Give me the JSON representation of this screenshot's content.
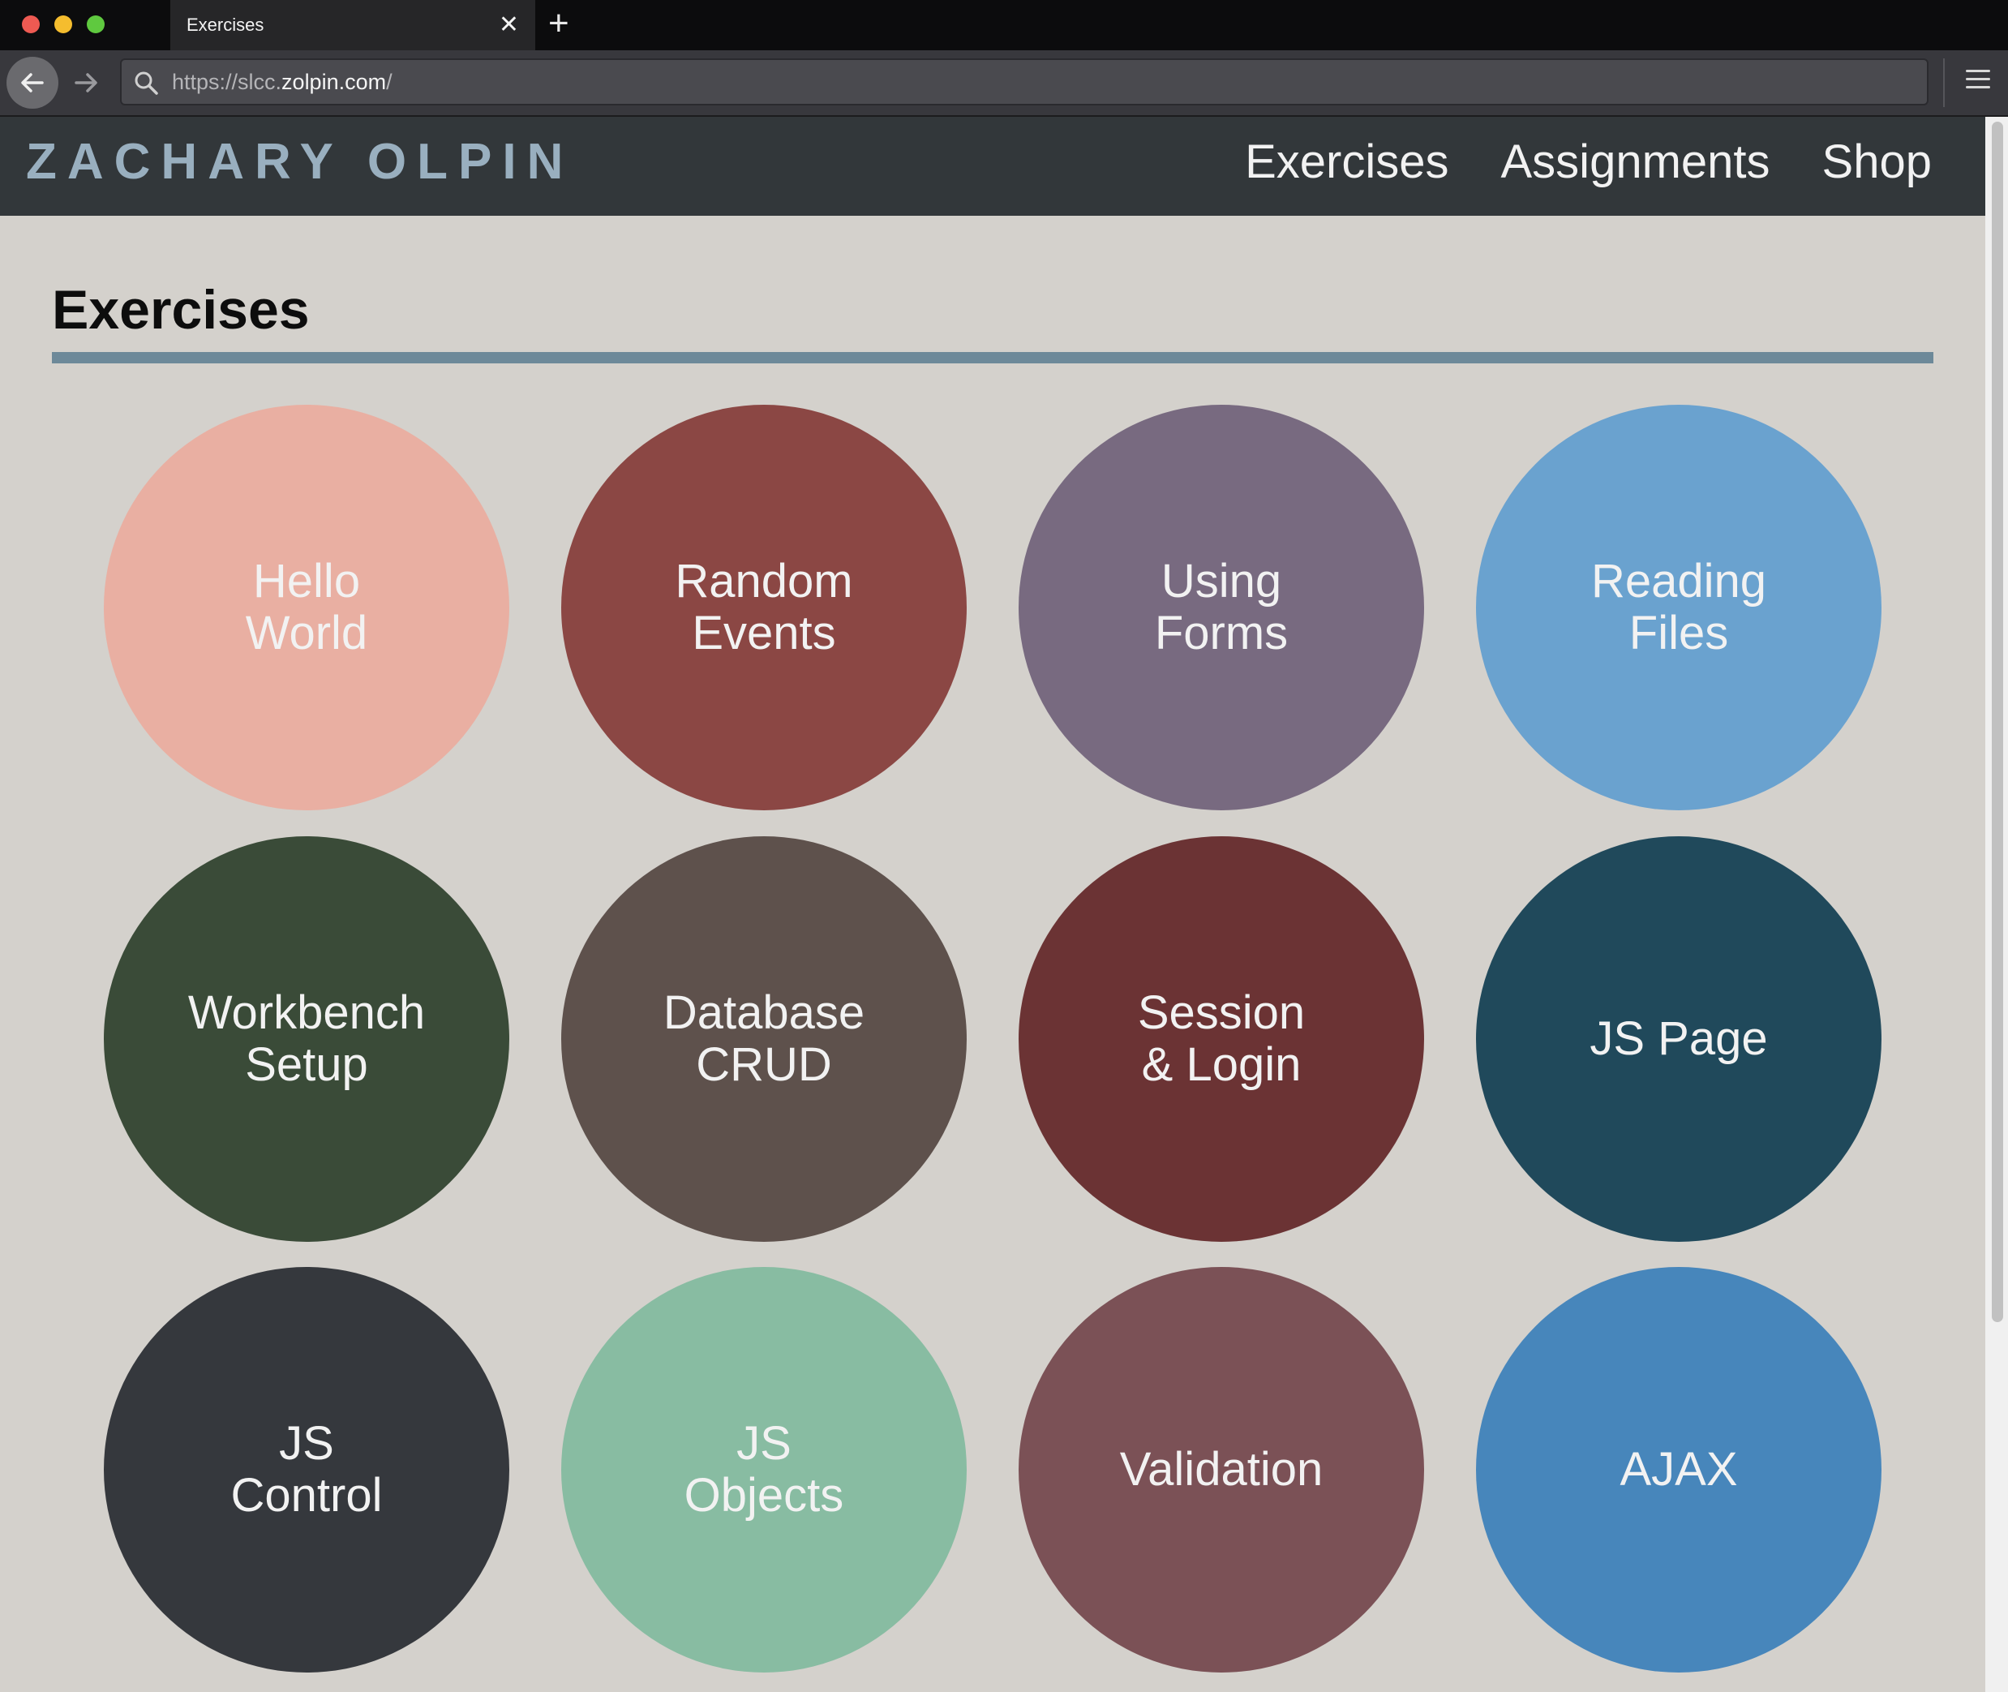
{
  "browser": {
    "tab_title": "Exercises",
    "tab_close": "✕",
    "new_tab": "+",
    "url_prefix": "https://slcc.",
    "url_domain": "zolpin.com",
    "url_suffix": "/"
  },
  "site": {
    "logo": "ZACHARY OLPIN",
    "nav": [
      "Exercises",
      "Assignments",
      "Shop"
    ]
  },
  "page": {
    "title": "Exercises"
  },
  "exercises": [
    {
      "label": "Hello\nWorld",
      "color": "#e9afa2"
    },
    {
      "label": "Random\nEvents",
      "color": "#8b4744"
    },
    {
      "label": "Using\nForms",
      "color": "#786a80"
    },
    {
      "label": "Reading\nFiles",
      "color": "#6aa2cf"
    },
    {
      "label": "Workbench\nSetup",
      "color": "#3a4b38"
    },
    {
      "label": "Database\nCRUD",
      "color": "#5e514c"
    },
    {
      "label": "Session\n& Login",
      "color": "#6b3334"
    },
    {
      "label": "JS Page",
      "color": "#20495b"
    },
    {
      "label": "JS\nControl",
      "color": "#35383d"
    },
    {
      "label": "JS\nObjects",
      "color": "#88bca2"
    },
    {
      "label": "Validation",
      "color": "#7b5156"
    },
    {
      "label": "AJAX",
      "color": "#4786bb"
    }
  ]
}
